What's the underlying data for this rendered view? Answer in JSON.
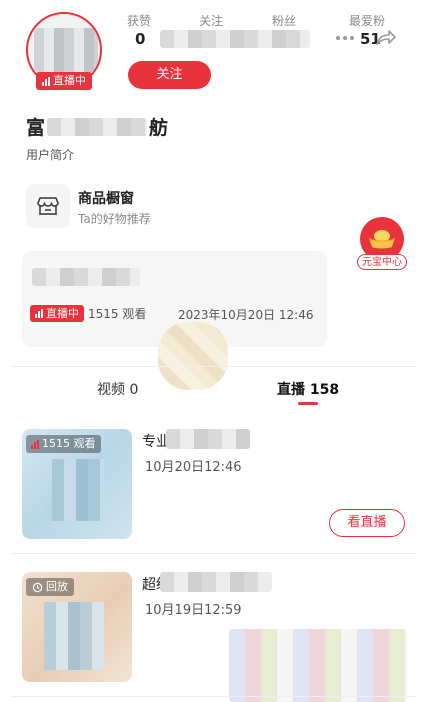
{
  "profile": {
    "live_badge": "直播中",
    "stats": [
      {
        "label": "获赞",
        "value": "0"
      },
      {
        "label": "关注",
        "value": ""
      },
      {
        "label": "粉丝",
        "value": ""
      },
      {
        "label": "最爱粉",
        "value": "51"
      }
    ],
    "follow_label": "关注",
    "name_prefix": "富",
    "name_suffix": "舫",
    "bio": "用户简介"
  },
  "shop": {
    "title": "商品橱窗",
    "subtitle": "Ta的好物推荐",
    "icon": "shop-icon"
  },
  "yuanbao": {
    "label": "元宝中心",
    "icon": "gold-ingot-icon"
  },
  "live_card": {
    "status": "直播中",
    "viewers": "1515 观看",
    "time": "2023年10月20日 12:46"
  },
  "tabs": [
    {
      "label": "视频 0"
    },
    {
      "label": "直播 158"
    }
  ],
  "items": [
    {
      "badge": "1515 观看",
      "title_prefix": "专业",
      "date": "10月20日12:46",
      "action": "看直播"
    },
    {
      "badge": "回放",
      "title_prefix": "超级",
      "date": "10月19日12:59"
    }
  ],
  "colors": {
    "accent": "#e8323c",
    "gold": "#f5b82e"
  }
}
